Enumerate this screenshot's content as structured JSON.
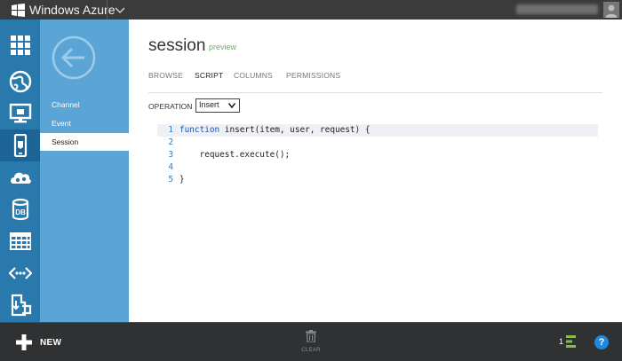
{
  "topbar": {
    "brand": "Windows Azure"
  },
  "nav_icons": [
    "grid-icon",
    "globe-icon",
    "monitor-icon",
    "mobile-device-icon",
    "cloud-services-icon",
    "database-icon",
    "table-storage-icon",
    "code-icon",
    "import-export-icon"
  ],
  "sidebar": {
    "items": [
      {
        "label": "Channel"
      },
      {
        "label": "Event"
      },
      {
        "label": "Session"
      }
    ],
    "active_index": 2
  },
  "main": {
    "title": "session",
    "badge": "preview",
    "tabs": [
      {
        "label": "BROWSE"
      },
      {
        "label": "SCRIPT"
      },
      {
        "label": "COLUMNS"
      },
      {
        "label": "PERMISSIONS"
      }
    ],
    "active_tab_index": 1,
    "operation": {
      "label": "OPERATION",
      "value": "Insert"
    }
  },
  "code": {
    "lines": [
      {
        "n": "1",
        "kw": "function",
        "text": " insert(item, user, request) {"
      },
      {
        "n": "2",
        "kw": "",
        "text": ""
      },
      {
        "n": "3",
        "kw": "",
        "text": "    request.execute();"
      },
      {
        "n": "4",
        "kw": "",
        "text": ""
      },
      {
        "n": "5",
        "kw": "",
        "text": "}"
      }
    ],
    "highlighted_line": 1
  },
  "bottombar": {
    "new_label": "NEW",
    "clear_label": "CLEAR",
    "jobs_count": "1",
    "help_label": "?"
  },
  "colors": {
    "topbar": "#3b3b3b",
    "leftnav": "#2a79ad",
    "subpanel": "#5aa5d6",
    "preview_badge": "#5cb85c",
    "keyword": "#1a55b8",
    "line_numbers": "#2f7ec1",
    "bottombar": "#2f3133",
    "jobs_accent": "#7cc242",
    "help": "#1e88e5"
  }
}
